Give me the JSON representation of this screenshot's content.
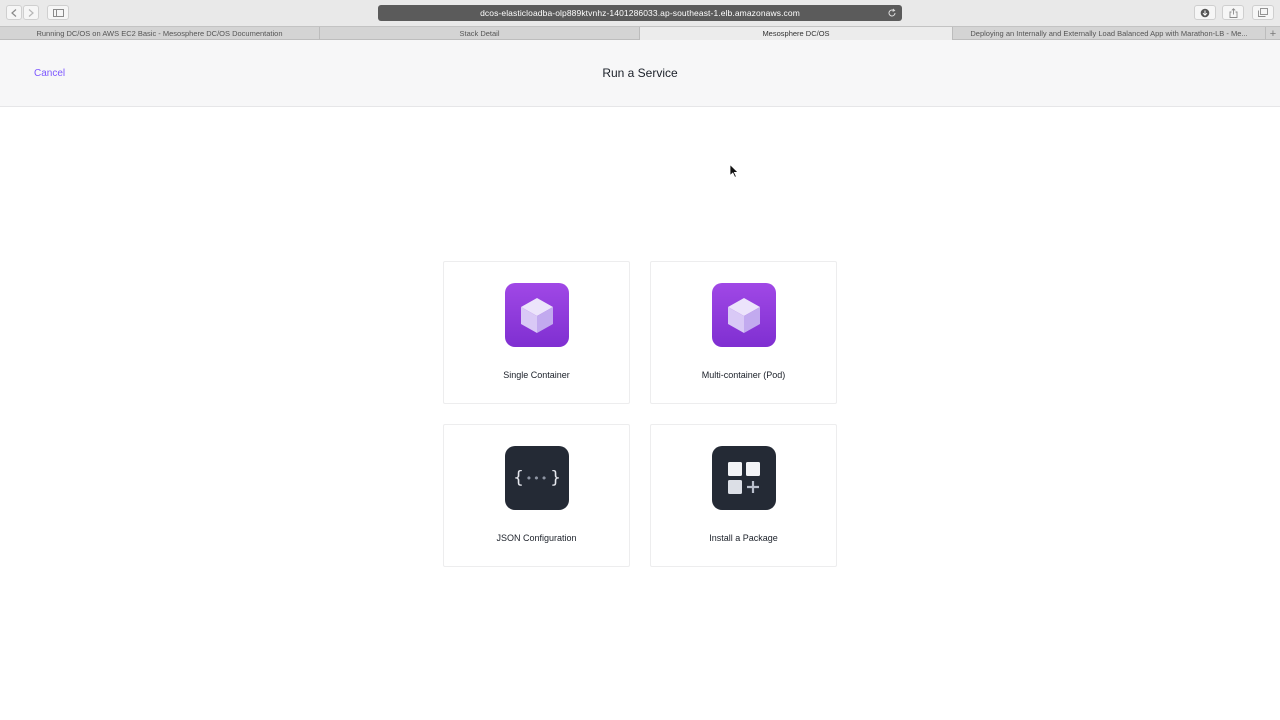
{
  "browser": {
    "url": "dcos-elasticloadba-olp889ktvnhz-1401286033.ap-southeast-1.elb.amazonaws.com",
    "tabs": [
      {
        "label": "Running DC/OS on AWS EC2 Basic - Mesosphere DC/OS Documentation",
        "active": false
      },
      {
        "label": "Stack Detail",
        "active": false
      },
      {
        "label": "Mesosphere DC/OS",
        "active": true
      },
      {
        "label": "Deploying an Internally and Externally Load Balanced App with Marathon-LB - Me...",
        "active": false
      }
    ],
    "new_tab_label": "+"
  },
  "header": {
    "cancel_label": "Cancel",
    "title": "Run a Service"
  },
  "options": [
    {
      "label": "Single Container",
      "icon": "cube-icon",
      "tile_color": "#8e3ad9"
    },
    {
      "label": "Multi-container (Pod)",
      "icon": "cube-icon",
      "tile_color": "#8e3ad9"
    },
    {
      "label": "JSON Configuration",
      "icon": "json-braces-icon",
      "tile_color": "#242a35"
    },
    {
      "label": "Install a Package",
      "icon": "package-grid-plus-icon",
      "tile_color": "#242a35"
    }
  ],
  "colors": {
    "accent": "#7d58ff",
    "purple_tile": "#8e3ad9",
    "dark_tile": "#242a35"
  }
}
